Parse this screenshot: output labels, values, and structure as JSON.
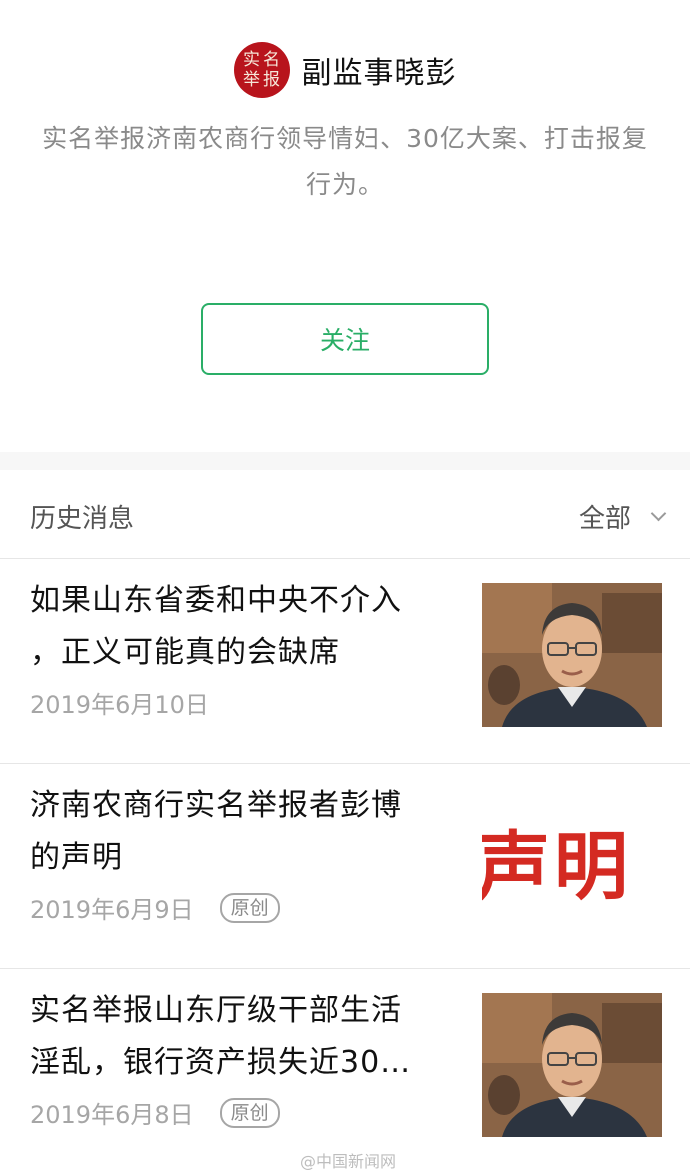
{
  "profile": {
    "avatar_chars": [
      "实",
      "名",
      "举",
      "报"
    ],
    "name": "副监事晓彭",
    "description": "实名举报济南农商行领导情妇、30亿大案、打击报复行为。",
    "follow_label": "关注"
  },
  "history": {
    "title": "历史消息",
    "filter_label": "全部",
    "articles": [
      {
        "title": "如果山东省委和中央不介入\n，正义可能真的会缺席",
        "date": "2019年6月10日",
        "badge": "",
        "thumb_type": "photo"
      },
      {
        "title": "济南农商行实名举报者彭博\n的声明",
        "date": "2019年6月9日",
        "badge": "原创",
        "thumb_type": "text",
        "thumb_text": "声明"
      },
      {
        "title": "实名举报山东厅级干部生活\n淫乱，银行资产损失近30…",
        "date": "2019年6月8日",
        "badge": "原创",
        "thumb_type": "photo"
      }
    ]
  },
  "watermark": "@中国新闻网",
  "colors": {
    "accent": "#2aae67",
    "avatar_red": "#b8141c",
    "thumb_red": "#d42a22"
  }
}
